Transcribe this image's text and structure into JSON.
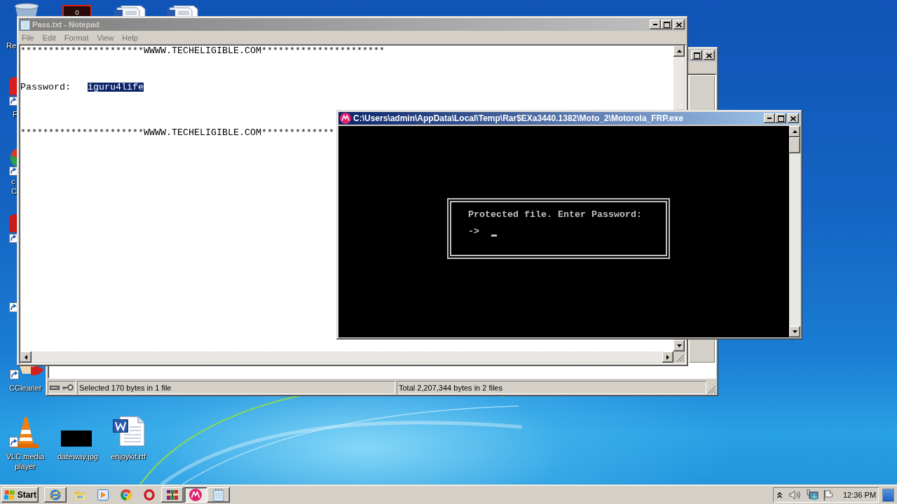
{
  "desktop": {
    "icons": [
      {
        "label": "Re"
      },
      {
        "label": "F"
      },
      {
        "label": "c C"
      },
      {
        "label": "CCleaner"
      },
      {
        "label": "VLC media player"
      },
      {
        "label": "dateway.jpg"
      },
      {
        "label": "enjoykit.rtf"
      }
    ]
  },
  "winrar_window": {
    "active": false,
    "status_bar": [
      "Selected 170 bytes in 1 file",
      "Total 2,207,344 bytes in 2 files"
    ]
  },
  "notepad_window": {
    "title": "Pass.txt - Notepad",
    "active": false,
    "menu": [
      "File",
      "Edit",
      "Format",
      "View",
      "Help"
    ],
    "lines": [
      {
        "kind": "banner",
        "text": "**********************WWWW.TECHELIGIBLE.COM**********************"
      },
      {
        "kind": "field",
        "label": "Password:",
        "value": "iguru4life",
        "selected": true
      },
      {
        "kind": "banner",
        "text": "**********************WWWW.TECHELIGIBLE.COM*************"
      }
    ]
  },
  "console_window": {
    "title": "C:\\Users\\admin\\AppData\\Local\\Temp\\Rar$EXa3440.1382\\Moto_2\\Motorola_FRP.exe",
    "active": true,
    "dialog": {
      "message": "Protected file. Enter Password:",
      "prompt": "->"
    }
  },
  "taskbar": {
    "start": "Start",
    "buttons": [
      {
        "kind": "window",
        "selected": false
      },
      {
        "kind": "launcher"
      },
      {
        "kind": "launcher"
      },
      {
        "kind": "launcher"
      },
      {
        "kind": "launcher"
      },
      {
        "kind": "window",
        "selected": false
      },
      {
        "kind": "window",
        "selected": true
      },
      {
        "kind": "window",
        "selected": false
      }
    ],
    "clock": "12:36 PM"
  }
}
